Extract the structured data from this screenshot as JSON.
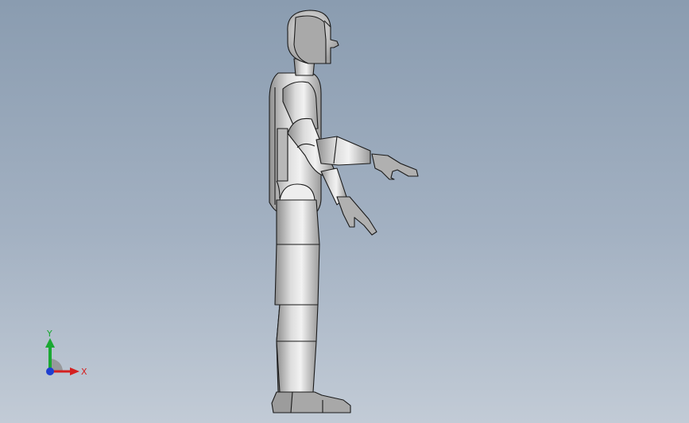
{
  "viewport": {
    "background_top": "#8a9cb0",
    "background_bottom": "#c2cbd6"
  },
  "model": {
    "body_color": "#c8c8c8",
    "shade_color": "#a8a8a8",
    "edge_color": "#1a1a1a"
  },
  "triad": {
    "y_label": "Y",
    "x_label": "X",
    "y_color": "#1aa832",
    "x_color": "#d42020",
    "z_color": "#1f3fd0"
  }
}
